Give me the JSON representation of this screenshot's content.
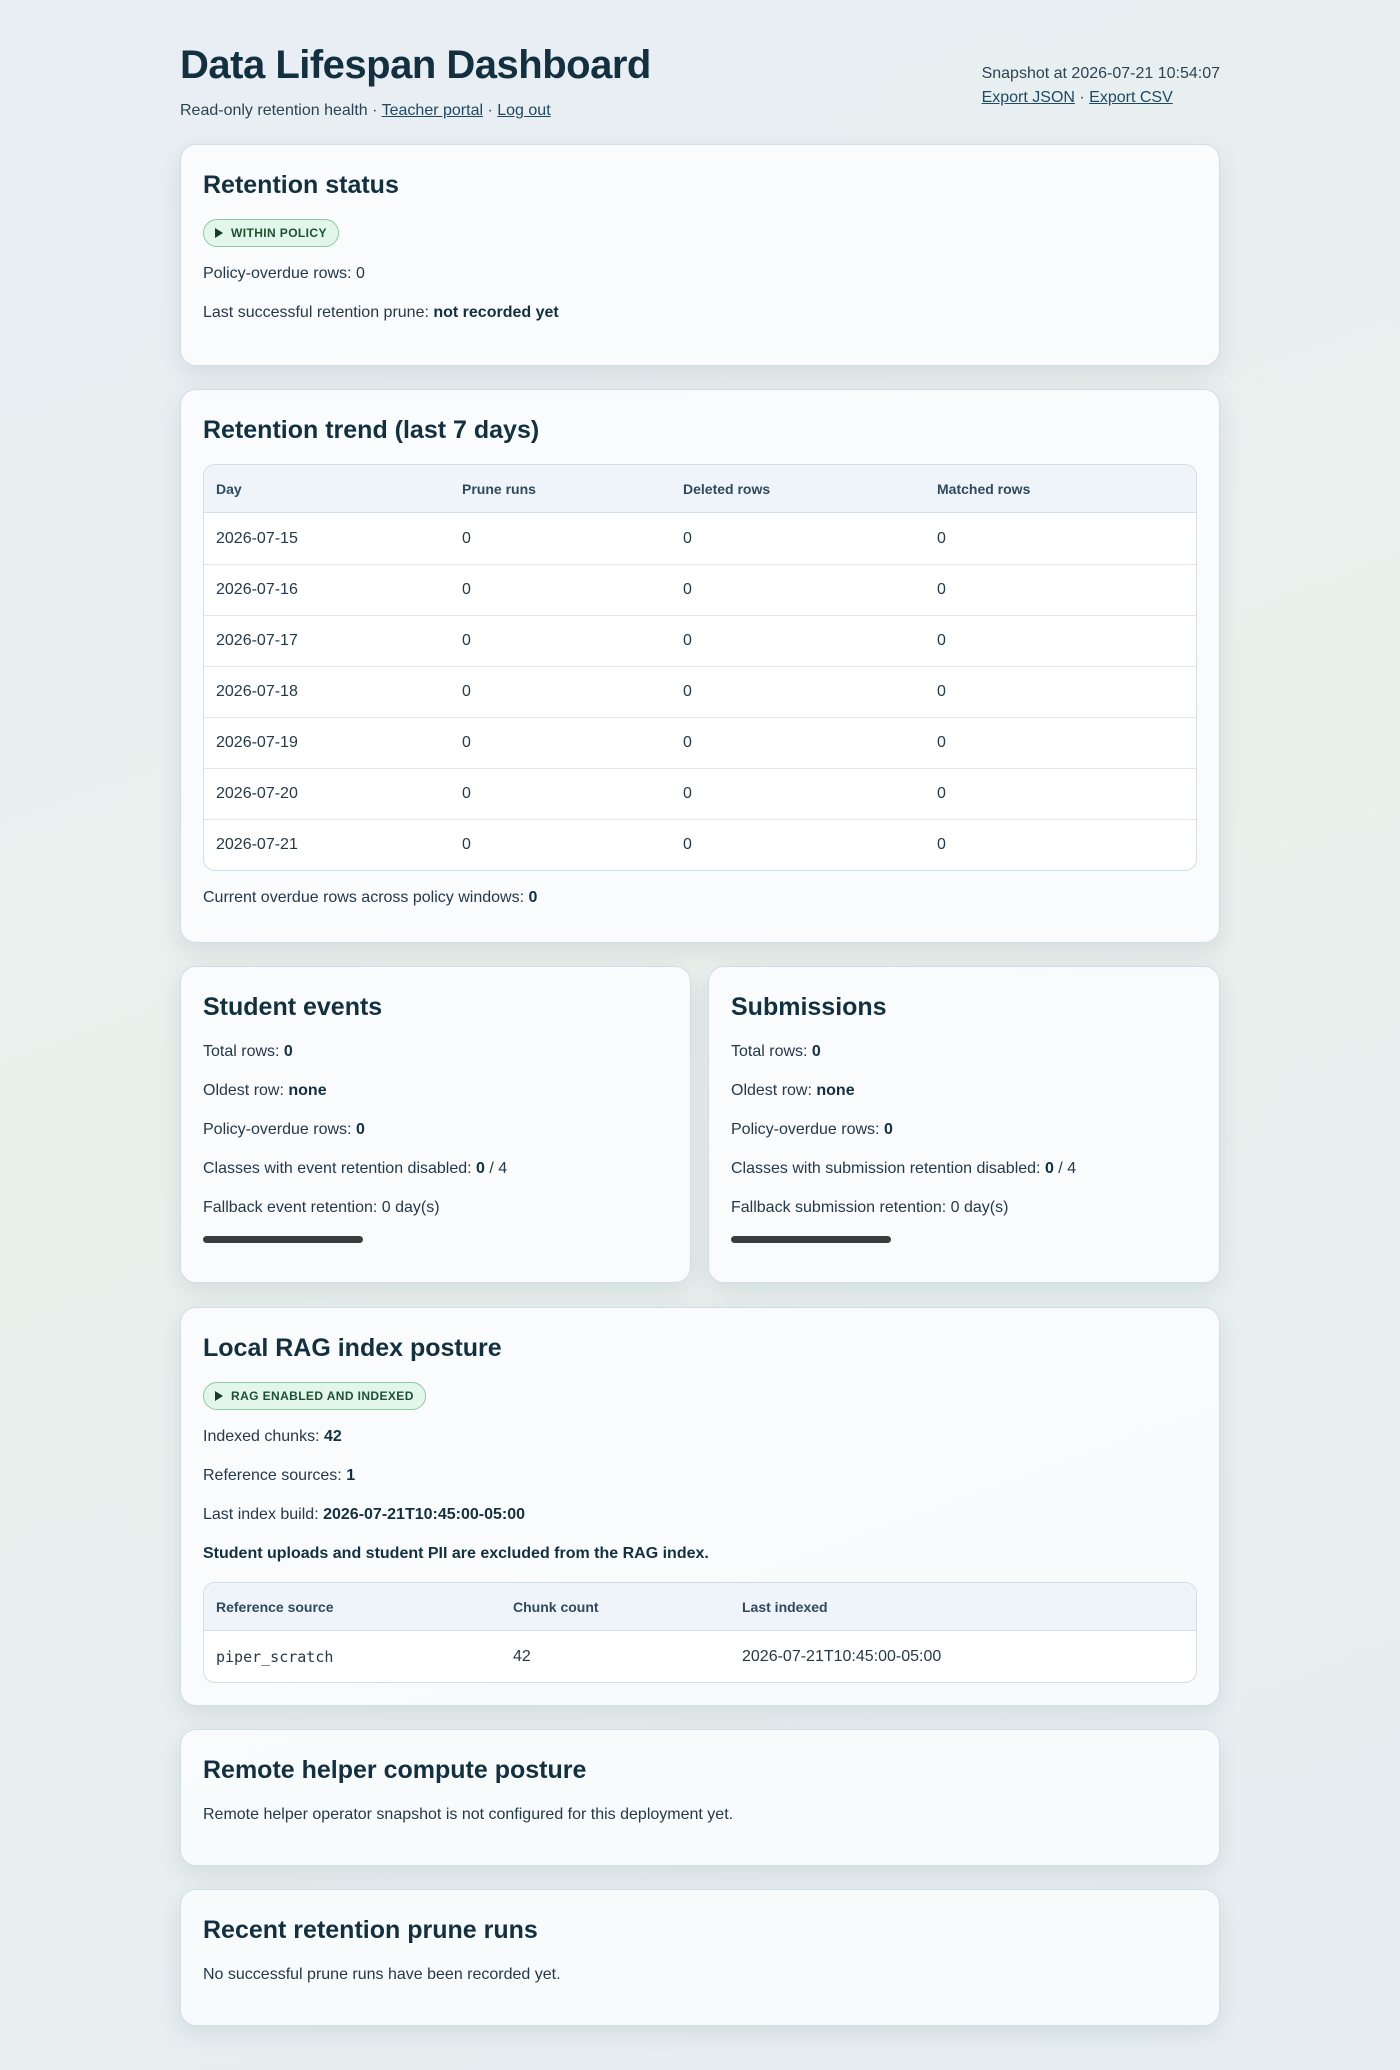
{
  "header": {
    "title": "Data Lifespan Dashboard",
    "subtitle": "Read-only retention health",
    "sep": "·",
    "teacher_portal": "Teacher portal",
    "logout": "Log out",
    "snapshot": "Snapshot at 2026-07-21 10:54:07",
    "export_json": "Export JSON",
    "export_csv": "Export CSV"
  },
  "retention_status": {
    "title": "Retention status",
    "badge": "WITHIN POLICY",
    "overdue_line": "Policy-overdue rows: 0",
    "last_prune_label": "Last successful retention prune:",
    "last_prune_value": "not recorded yet"
  },
  "trend": {
    "title": "Retention trend (last 7 days)",
    "columns": [
      "Day",
      "Prune runs",
      "Deleted rows",
      "Matched rows"
    ],
    "rows": [
      [
        "2026-07-15",
        "0",
        "0",
        "0"
      ],
      [
        "2026-07-16",
        "0",
        "0",
        "0"
      ],
      [
        "2026-07-17",
        "0",
        "0",
        "0"
      ],
      [
        "2026-07-18",
        "0",
        "0",
        "0"
      ],
      [
        "2026-07-19",
        "0",
        "0",
        "0"
      ],
      [
        "2026-07-20",
        "0",
        "0",
        "0"
      ],
      [
        "2026-07-21",
        "0",
        "0",
        "0"
      ]
    ],
    "overdue_label": "Current overdue rows across policy windows:",
    "overdue_value": "0"
  },
  "student_events": {
    "title": "Student events",
    "total_label": "Total rows:",
    "total_value": "0",
    "oldest_label": "Oldest row:",
    "oldest_value": "none",
    "overdue_label": "Policy-overdue rows:",
    "overdue_value": "0",
    "disabled_label": "Classes with event retention disabled:",
    "disabled_value": "0",
    "disabled_total": "/ 4",
    "fallback": "Fallback event retention: 0 day(s)"
  },
  "submissions": {
    "title": "Submissions",
    "total_label": "Total rows:",
    "total_value": "0",
    "oldest_label": "Oldest row:",
    "oldest_value": "none",
    "overdue_label": "Policy-overdue rows:",
    "overdue_value": "0",
    "disabled_label": "Classes with submission retention disabled:",
    "disabled_value": "0",
    "disabled_total": "/ 4",
    "fallback": "Fallback submission retention: 0 day(s)"
  },
  "rag": {
    "title": "Local RAG index posture",
    "badge": "RAG ENABLED AND INDEXED",
    "chunks_label": "Indexed chunks:",
    "chunks_value": "42",
    "sources_label": "Reference sources:",
    "sources_value": "1",
    "build_label": "Last index build:",
    "build_value": "2026-07-21T10:45:00-05:00",
    "note": "Student uploads and student PII are excluded from the RAG index.",
    "columns": [
      "Reference source",
      "Chunk count",
      "Last indexed"
    ],
    "rows": [
      [
        "piper_scratch",
        "42",
        "2026-07-21T10:45:00-05:00"
      ]
    ]
  },
  "remote": {
    "title": "Remote helper compute posture",
    "text": "Remote helper operator snapshot is not configured for this deployment yet."
  },
  "recent": {
    "title": "Recent retention prune runs",
    "text": "No successful prune runs have been recorded yet."
  },
  "colors": {
    "badge_bg": "#e2f6ea",
    "badge_border": "#8fc9a4",
    "title": "#12303f"
  }
}
